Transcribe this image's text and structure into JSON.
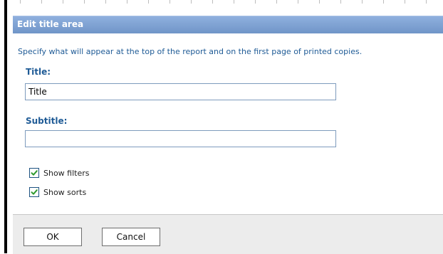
{
  "dialog": {
    "title": "Edit title area",
    "description": "Specify what will appear at the top of the report and on the first page of printed copies."
  },
  "fields": {
    "title_label": "Title:",
    "title_value": "Title",
    "subtitle_label": "Subtitle:",
    "subtitle_value": ""
  },
  "options": {
    "show_filters_label": "Show filters",
    "show_filters_checked": true,
    "show_sorts_label": "Show sorts",
    "show_sorts_checked": true
  },
  "buttons": {
    "ok_label": "OK",
    "cancel_label": "Cancel"
  },
  "colors": {
    "header_bg": "#7f9fcf",
    "label_text": "#1f5b96",
    "checkmark": "#2f9a2f"
  }
}
